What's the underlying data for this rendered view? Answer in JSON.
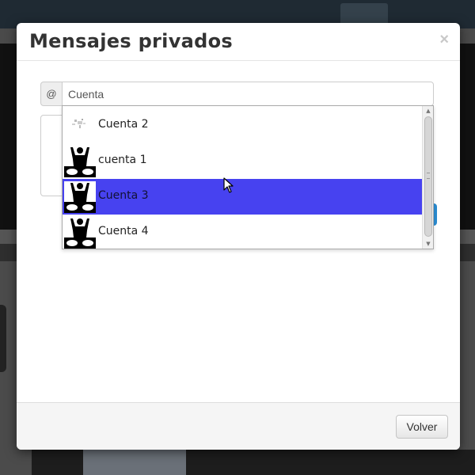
{
  "modal": {
    "title": "Mensajes privados",
    "close_symbol": "×"
  },
  "recipient": {
    "addon_symbol": "@",
    "value": "Cuenta"
  },
  "suggestions": [
    {
      "label": "Cuenta 2",
      "avatar": "photo-placeholder-icon",
      "selected": false
    },
    {
      "label": "cuenta 1",
      "avatar": "dj-silhouette-icon",
      "selected": false
    },
    {
      "label": "Cuenta 3",
      "avatar": "dj-silhouette-icon",
      "selected": true
    },
    {
      "label": "Cuenta 4",
      "avatar": "dj-silhouette-icon",
      "selected": false
    }
  ],
  "footer": {
    "back_label": "Volver"
  },
  "colors": {
    "highlight": "#4742f0",
    "send_button": "#2a8bd0",
    "title_text": "#333333"
  }
}
